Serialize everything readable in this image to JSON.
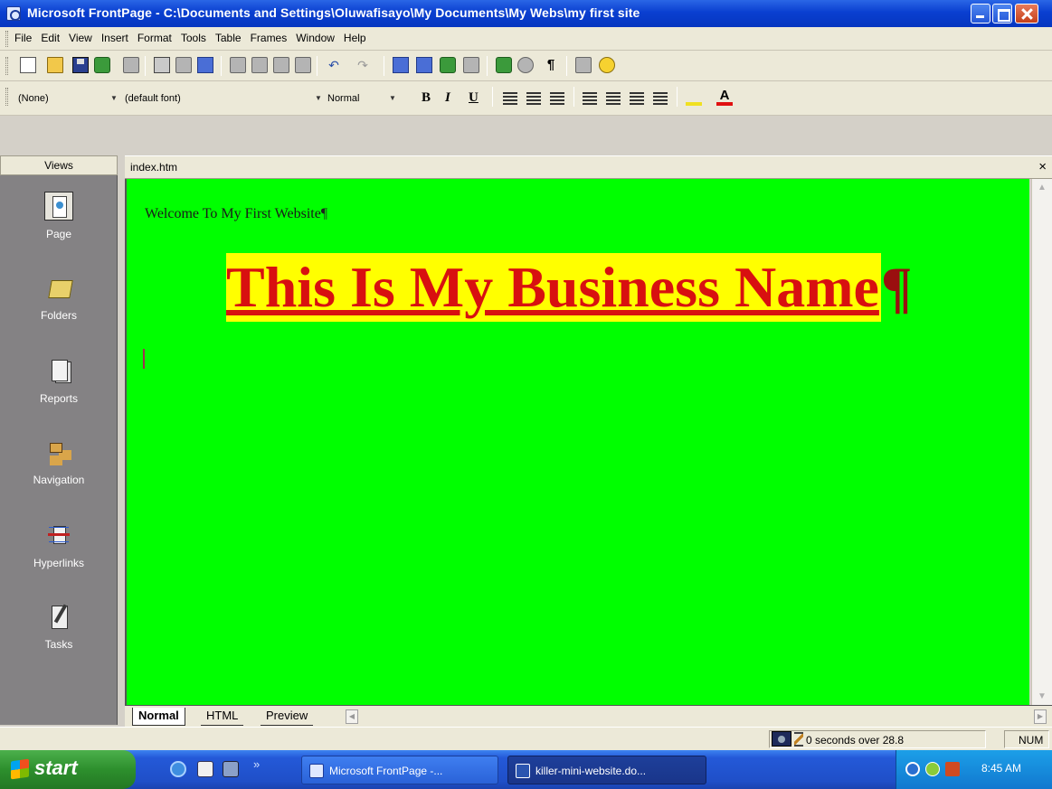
{
  "window": {
    "title": "Microsoft FrontPage - C:\\Documents and Settings\\Oluwafisayo\\My Documents\\My Webs\\my first site"
  },
  "menu": [
    "File",
    "Edit",
    "View",
    "Insert",
    "Format",
    "Tools",
    "Table",
    "Frames",
    "Window",
    "Help"
  ],
  "formatting": {
    "style": "(None)",
    "font": "(default font)",
    "size": "Normal",
    "bold": "B",
    "italic": "I",
    "underline": "U"
  },
  "views_panel": {
    "header": "Views",
    "items": [
      {
        "label": "Page",
        "icon": "page-icon",
        "active": true
      },
      {
        "label": "Folders",
        "icon": "folder-icon"
      },
      {
        "label": "Reports",
        "icon": "reports-icon"
      },
      {
        "label": "Navigation",
        "icon": "navigation-icon"
      },
      {
        "label": "Hyperlinks",
        "icon": "hyperlinks-icon"
      },
      {
        "label": "Tasks",
        "icon": "tasks-icon"
      }
    ]
  },
  "document": {
    "tab_name": "index.htm",
    "close_glyph": "×",
    "background_color": "#00ff00",
    "welcome_text": "Welcome To My First Website",
    "pilcrow": "¶",
    "heading": "This Is My Business Name",
    "heading_color": "#d81010",
    "heading_highlight": "#ffff00"
  },
  "view_tabs": [
    "Normal",
    "HTML",
    "Preview"
  ],
  "status": {
    "download_time": "0 seconds over 28.8",
    "num_lock": "NUM"
  },
  "taskbar": {
    "start_label": "start",
    "quick_launch_more": "»",
    "tasks": [
      {
        "label": "Microsoft FrontPage -...",
        "active": true
      },
      {
        "label": "killer-mini-website.do..."
      }
    ],
    "clock": "8:45 AM"
  }
}
